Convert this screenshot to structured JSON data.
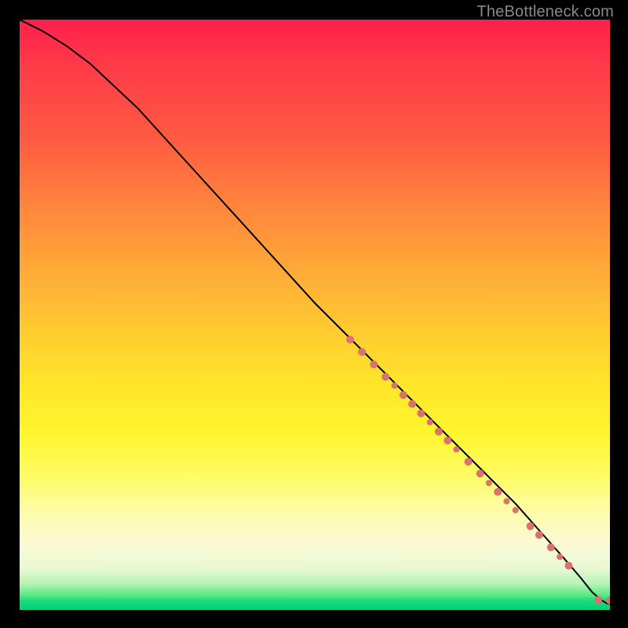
{
  "watermark": "TheBottleneck.com",
  "colors": {
    "chart_bg_top": "#ff1f4a",
    "chart_bg_bottom": "#00d080",
    "curve": "#000000",
    "dot": "#d9746c",
    "page_bg": "#000000"
  },
  "chart_data": {
    "type": "line",
    "title": "",
    "xlabel": "",
    "ylabel": "",
    "xlim": [
      0,
      100
    ],
    "ylim": [
      0,
      100
    ],
    "grid": false,
    "legend": false,
    "series": [
      {
        "name": "curve",
        "x": [
          0,
          4,
          8,
          12,
          20,
          30,
          40,
          50,
          60,
          70,
          78,
          84,
          88,
          92,
          95,
          97,
          98.5,
          99.5,
          100
        ],
        "y": [
          100,
          98,
          95.5,
          92.5,
          85,
          74,
          63,
          52,
          42,
          32,
          24,
          18,
          13.5,
          9,
          5.5,
          3,
          1.7,
          1.1,
          1
        ]
      }
    ],
    "points": [
      {
        "x": 56,
        "y": 45.8,
        "r": 5
      },
      {
        "x": 58,
        "y": 43.7,
        "r": 5
      },
      {
        "x": 60,
        "y": 41.6,
        "r": 5
      },
      {
        "x": 62,
        "y": 39.5,
        "r": 5
      },
      {
        "x": 63.5,
        "y": 38.0,
        "r": 4
      },
      {
        "x": 65,
        "y": 36.4,
        "r": 5
      },
      {
        "x": 66.5,
        "y": 34.9,
        "r": 5
      },
      {
        "x": 68,
        "y": 33.3,
        "r": 5
      },
      {
        "x": 69.5,
        "y": 31.8,
        "r": 4
      },
      {
        "x": 71,
        "y": 30.2,
        "r": 5
      },
      {
        "x": 72.5,
        "y": 28.7,
        "r": 5
      },
      {
        "x": 74,
        "y": 27.2,
        "r": 4
      },
      {
        "x": 76,
        "y": 25.1,
        "r": 5
      },
      {
        "x": 78,
        "y": 23.1,
        "r": 5
      },
      {
        "x": 79.5,
        "y": 21.5,
        "r": 4
      },
      {
        "x": 81,
        "y": 20.0,
        "r": 5
      },
      {
        "x": 82.5,
        "y": 18.4,
        "r": 4
      },
      {
        "x": 84,
        "y": 16.9,
        "r": 4
      },
      {
        "x": 86.5,
        "y": 14.2,
        "r": 5
      },
      {
        "x": 88,
        "y": 12.7,
        "r": 5
      },
      {
        "x": 90,
        "y": 10.6,
        "r": 5
      },
      {
        "x": 91.5,
        "y": 9.0,
        "r": 4
      },
      {
        "x": 93,
        "y": 7.5,
        "r": 5
      },
      {
        "x": 98,
        "y": 1.7,
        "r": 5
      },
      {
        "x": 100,
        "y": 1.6,
        "r": 5
      }
    ]
  }
}
